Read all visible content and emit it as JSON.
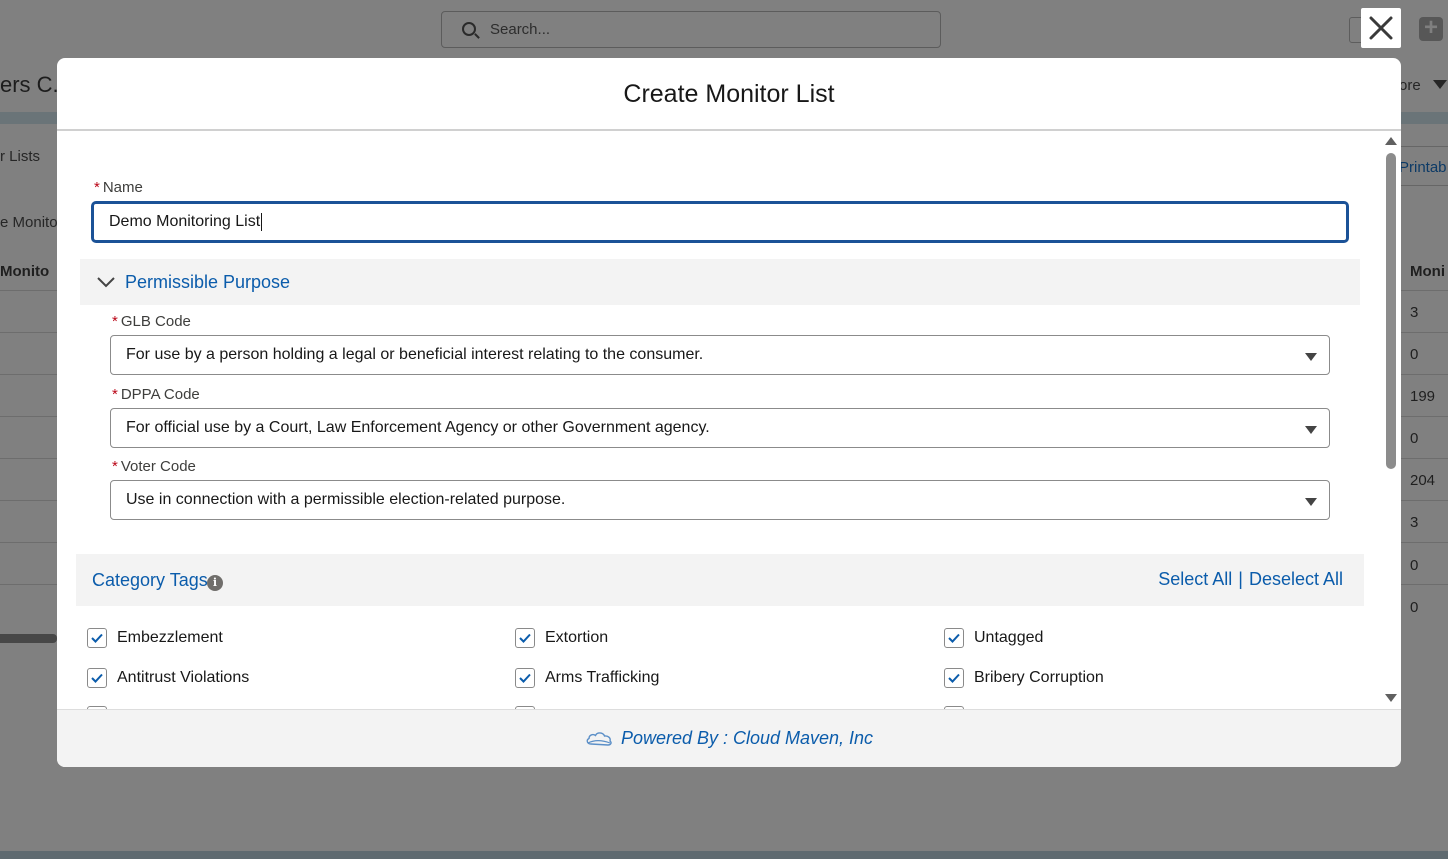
{
  "background": {
    "search_placeholder": "Search...",
    "app_name": "ers C...",
    "more_label": "ore",
    "lists_label": "r Lists",
    "monitor_label": "e Monito",
    "column_head_left": "Monito",
    "printable_label": "Printab",
    "column_head_right": "Moni",
    "numbers": [
      "3",
      "0",
      "199",
      "0",
      "204",
      "3",
      "0",
      "0"
    ]
  },
  "modal": {
    "title": "Create Monitor List",
    "name_field": {
      "required_mark": "*",
      "label": "Name",
      "value": "Demo Monitoring List"
    },
    "permissible_purpose": {
      "title": "Permissible Purpose",
      "glb": {
        "required_mark": "*",
        "label": "GLB Code",
        "value": "For use by a person holding a legal or beneficial interest relating to the consumer."
      },
      "dppa": {
        "required_mark": "*",
        "label": "DPPA Code",
        "value": "For official use by a Court, Law Enforcement Agency or other Government agency."
      },
      "voter": {
        "required_mark": "*",
        "label": "Voter Code",
        "value": "Use in connection with a permissible election-related purpose."
      }
    },
    "category_tags": {
      "title": "Category Tags",
      "info_glyph": "i",
      "select_all": "Select All",
      "separator": "|",
      "deselect_all": "Deselect All",
      "items": [
        {
          "label": "Embezzlement",
          "checked": true
        },
        {
          "label": "Extortion",
          "checked": true
        },
        {
          "label": "Untagged",
          "checked": true
        },
        {
          "label": "Antitrust Violations",
          "checked": true
        },
        {
          "label": "Arms Trafficking",
          "checked": true
        },
        {
          "label": "Bribery Corruption",
          "checked": true
        }
      ]
    },
    "footer": {
      "text": "Powered By : Cloud Maven, Inc"
    }
  },
  "colors": {
    "brand_blue": "#0b5cab",
    "focus_border": "#1b5297",
    "required_red": "#ba0517",
    "section_bg": "#f3f3f3"
  },
  "icons": {
    "close": "close-icon",
    "chevron": "chevron-down-icon",
    "info": "info-icon",
    "check": "checkmark-icon",
    "cloud": "cloud-logo-icon",
    "search": "search-icon"
  }
}
